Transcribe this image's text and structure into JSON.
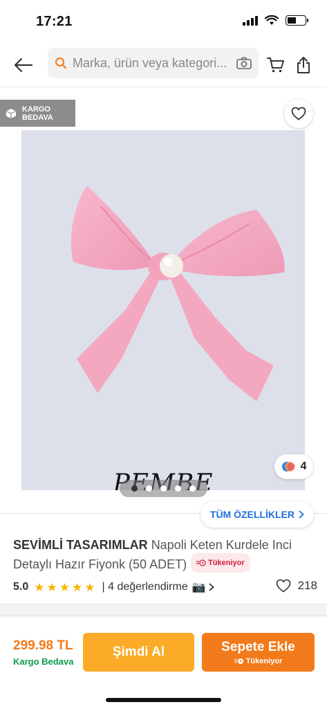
{
  "status_bar": {
    "time": "17:21",
    "battery_level": 0.5
  },
  "header": {
    "search_placeholder": "Marka, ürün veya kategori...",
    "icons": [
      "back-arrow-icon",
      "search-icon",
      "camera-icon",
      "cart-icon",
      "share-icon"
    ]
  },
  "gallery": {
    "cargo_badge_line1": "KARGO",
    "cargo_badge_line2": "BEDAVA",
    "image_text": "PEMBE",
    "variant_count": "4",
    "dots_total": 5,
    "dots_active": 1
  },
  "product": {
    "features_label": "TÜM ÖZELLİKLER",
    "brand": "SEVİMLİ TASARIMLAR",
    "name": "Napoli Keten Kurdele Inci Detaylı Hazır Fiyonk (50 ADET)",
    "stock_label": "Tükeniyor",
    "rating": "5.0",
    "stars": 5,
    "reviews": "| 4 değerlendirme",
    "favorites": "218"
  },
  "bottom_bar": {
    "price": "299.98 TL",
    "cargo_free": "Kargo Bedava",
    "buy_now_label": "Şimdi Al",
    "add_cart_label": "Sepete Ekle",
    "add_cart_sub": "Tükeniyor"
  },
  "colors": {
    "accent_orange": "#f27a1a",
    "buy_now_orange": "#fbab27",
    "cargo_green": "#0a9c4b",
    "star_yellow": "#f7b500",
    "link_blue": "#1e6fd9",
    "stock_red": "#d21f3c"
  }
}
